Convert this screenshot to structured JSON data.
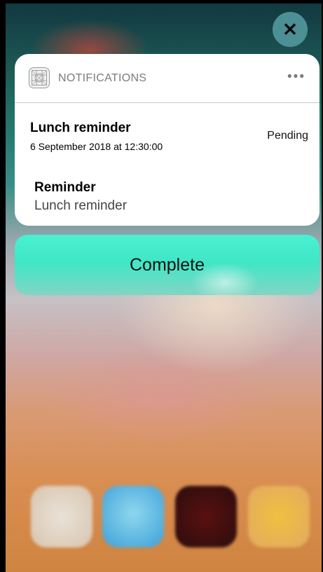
{
  "close_icon": "close-icon",
  "notification": {
    "app_icon": "app-grid-icon",
    "app_name": "NOTIFICATIONS",
    "more_icon": "ellipsis-icon",
    "more_label": "•••",
    "title": "Lunch reminder",
    "subtitle": "6 September 2018 at 12:30:00",
    "status": "Pending",
    "detail_label": "Reminder",
    "detail_value": "Lunch reminder"
  },
  "action": {
    "label": "Complete"
  },
  "dock_icons": [
    "dock-app-icon",
    "dock-app-icon",
    "dock-app-icon",
    "dock-app-icon"
  ],
  "colors": {
    "action_button": "#3fe7c6",
    "close_button": "#4c8f94",
    "card": "#ffffff"
  }
}
